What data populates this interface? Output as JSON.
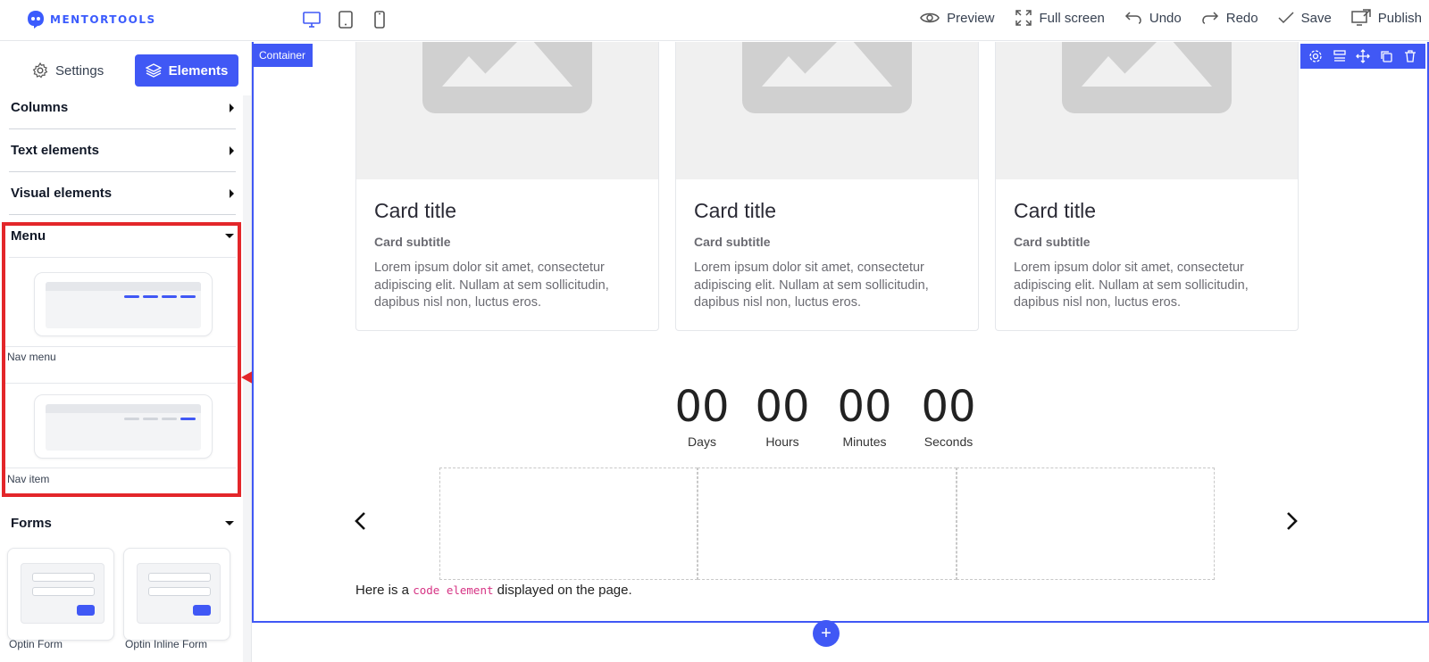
{
  "app": {
    "brand": "MENTORTOOLS"
  },
  "topbar": {
    "devices": [
      "desktop-icon",
      "tablet-icon",
      "mobile-icon"
    ],
    "actions": [
      {
        "label": "Preview",
        "icon": "eye-icon"
      },
      {
        "label": "Full screen",
        "icon": "expand-icon"
      },
      {
        "label": "Undo",
        "icon": "undo-icon"
      },
      {
        "label": "Redo",
        "icon": "redo-icon"
      },
      {
        "label": "Save",
        "icon": "check-icon"
      },
      {
        "label": "Publish",
        "icon": "publish-icon"
      }
    ]
  },
  "sidebar": {
    "tabs": {
      "settings": "Settings",
      "elements": "Elements"
    },
    "sections": {
      "columns": "Columns",
      "text": "Text elements",
      "visual": "Visual elements",
      "menu": "Menu",
      "forms": "Forms"
    },
    "menu_items": {
      "nav_menu": "Nav menu",
      "nav_item": "Nav item"
    },
    "form_items": {
      "optin": "Optin Form",
      "optin_inline": "Optin Inline Form"
    }
  },
  "canvas": {
    "container_label": "Container",
    "cards": [
      {
        "title": "Card title",
        "subtitle": "Card subtitle",
        "body": "Lorem ipsum dolor sit amet, consectetur adipiscing elit. Nullam at sem sollicitudin, dapibus nisl non, luctus eros."
      },
      {
        "title": "Card title",
        "subtitle": "Card subtitle",
        "body": "Lorem ipsum dolor sit amet, consectetur adipiscing elit. Nullam at sem sollicitudin, dapibus nisl non, luctus eros."
      },
      {
        "title": "Card title",
        "subtitle": "Card subtitle",
        "body": "Lorem ipsum dolor sit amet, consectetur adipiscing elit. Nullam at sem sollicitudin, dapibus nisl non, luctus eros."
      }
    ],
    "countdown": [
      {
        "value": "00",
        "label": "Days"
      },
      {
        "value": "00",
        "label": "Hours"
      },
      {
        "value": "00",
        "label": "Minutes"
      },
      {
        "value": "00",
        "label": "Seconds"
      }
    ],
    "code_text": {
      "before": "Here is a ",
      "code": "code element",
      "after": " displayed on the page."
    },
    "add_label": "+"
  },
  "colors": {
    "accent": "#4058f5",
    "highlight": "#e3262a"
  }
}
